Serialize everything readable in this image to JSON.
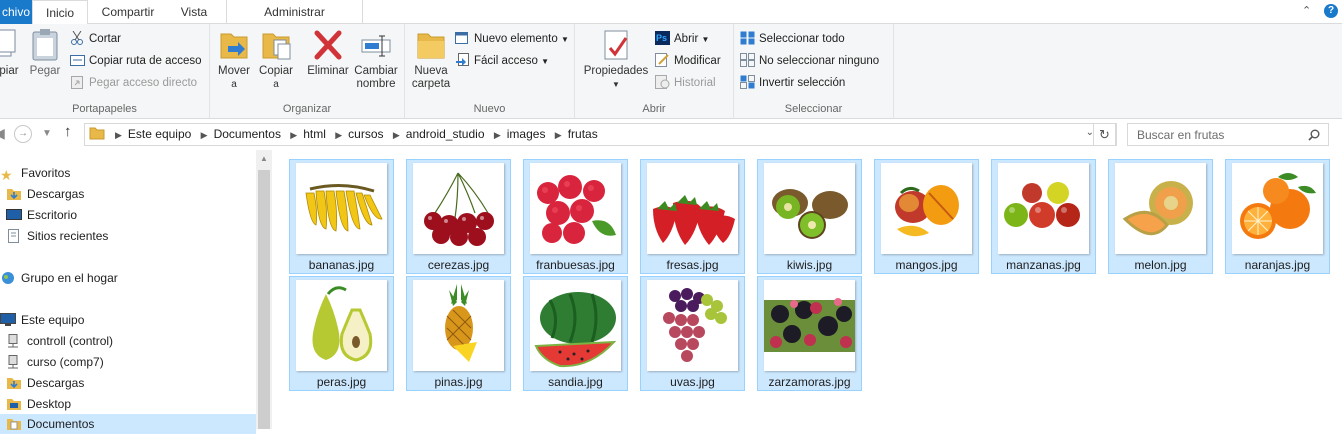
{
  "ribbon_tabs": {
    "file": "chivo",
    "home": "Inicio",
    "share": "Compartir",
    "view": "Vista",
    "manage": "Administrar"
  },
  "ribbon": {
    "clipboard": {
      "copy": "piar",
      "paste": "Pegar",
      "cut": "Cortar",
      "copy_path": "Copiar ruta de acceso",
      "paste_shortcut": "Pegar acceso directo",
      "label": "Portapapeles"
    },
    "organize": {
      "move_l1": "Mover",
      "move_l2": "a",
      "copy_l1": "Copiar",
      "copy_l2": "a",
      "delete": "Eliminar",
      "rename_l1": "Cambiar",
      "rename_l2": "nombre",
      "label": "Organizar"
    },
    "new": {
      "folder_l1": "Nueva",
      "folder_l2": "carpeta",
      "new_item": "Nuevo elemento",
      "easy_access": "Fácil acceso",
      "label": "Nuevo"
    },
    "open": {
      "properties": "Propiedades",
      "open": "Abrir",
      "edit": "Modificar",
      "history": "Historial",
      "label": "Abrir"
    },
    "select": {
      "all": "Seleccionar todo",
      "none": "No seleccionar ninguno",
      "invert": "Invertir selección",
      "label": "Seleccionar"
    }
  },
  "breadcrumb": [
    "Este equipo",
    "Documentos",
    "html",
    "cursos",
    "android_studio",
    "images",
    "frutas"
  ],
  "search": {
    "placeholder": "Buscar en frutas"
  },
  "nav": {
    "favorites": "Favoritos",
    "downloads": "Descargas",
    "desktop_es": "Escritorio",
    "recent": "Sitios recientes",
    "homegroup": "Grupo en el hogar",
    "this_pc": "Este equipo",
    "control": "controll (control)",
    "curso": "curso (comp7)",
    "downloads2": "Descargas",
    "desktop": "Desktop",
    "documents": "Documentos"
  },
  "files": [
    "bananas.jpg",
    "cerezas.jpg",
    "franbuesas.jpg",
    "fresas.jpg",
    "kiwis.jpg",
    "mangos.jpg",
    "manzanas.jpg",
    "melon.jpg",
    "naranjas.jpg",
    "peras.jpg",
    "pinas.jpg",
    "sandia.jpg",
    "uvas.jpg",
    "zarzamoras.jpg"
  ],
  "colors": {
    "accent": "#1979ca",
    "selection": "#cce8ff",
    "selection_border": "#99d1ff"
  }
}
